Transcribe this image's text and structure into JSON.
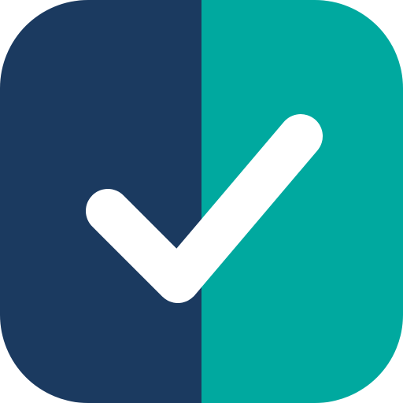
{
  "icon": {
    "name": "checkbox-checked-icon",
    "colors": {
      "left_half": "#1b3a60",
      "right_half": "#00a99f",
      "check_mark": "#ffffff"
    }
  }
}
